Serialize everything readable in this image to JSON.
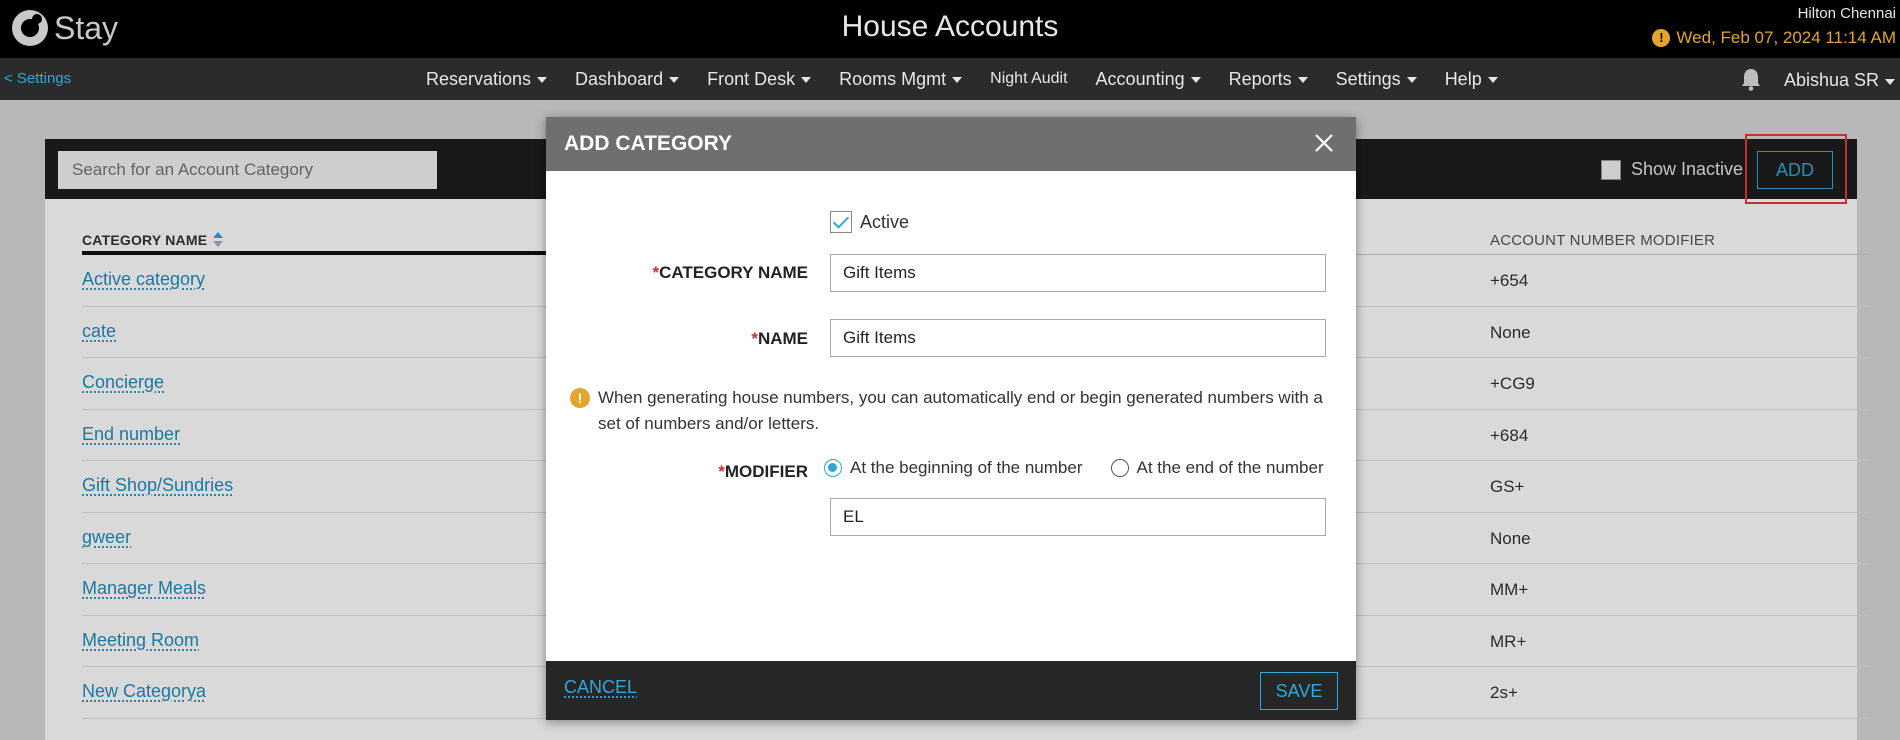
{
  "app": {
    "logo_text": "Stay",
    "page_title": "House Accounts"
  },
  "header": {
    "hotel_name": "Hilton Chennai",
    "datetime": "Wed, Feb 07, 2024 11:14 AM",
    "warning_icon": "!",
    "accent_color": "#e3a52b"
  },
  "nav": {
    "back_label": "<  Settings",
    "items": [
      {
        "label": "Reservations"
      },
      {
        "label": "Dashboard"
      },
      {
        "label": "Front Desk"
      },
      {
        "label": "Rooms Mgmt"
      },
      {
        "label": "Night Audit"
      },
      {
        "label": "Accounting"
      },
      {
        "label": "Reports"
      },
      {
        "label": "Settings"
      },
      {
        "label": "Help"
      }
    ],
    "user_name": "Abishua SR"
  },
  "panel": {
    "search_placeholder": "Search for an Account Category",
    "show_inactive_label": "Show Inactive",
    "add_label": "ADD",
    "col_category": "CATEGORY NAME",
    "col_modifier": "ACCOUNT NUMBER MODIFIER",
    "rows": [
      {
        "name": "Active category",
        "modifier": "+654"
      },
      {
        "name": "cate",
        "modifier": "None"
      },
      {
        "name": "Concierge",
        "modifier": "+CG9"
      },
      {
        "name": "End number",
        "modifier": "+684"
      },
      {
        "name": "Gift Shop/Sundries",
        "modifier": "GS+"
      },
      {
        "name": "gweer",
        "modifier": "None"
      },
      {
        "name": "Manager Meals",
        "modifier": "MM+"
      },
      {
        "name": "Meeting Room",
        "modifier": "MR+"
      },
      {
        "name": "New Categorya",
        "modifier": "2s+"
      }
    ]
  },
  "modal": {
    "title": "ADD CATEGORY",
    "active_label": "Active",
    "required_mark": "*",
    "category_name_label": "CATEGORY NAME",
    "category_name_value": "Gift Items",
    "name_label": "NAME",
    "name_value": "Gift Items",
    "info_icon": "!",
    "info_text": "When generating house numbers, you can automatically end or begin generated numbers with a set of numbers and/or letters.",
    "modifier_label": "MODIFIER",
    "radio_begin": "At the beginning of the number",
    "radio_end": "At the end of the number",
    "modifier_value": "EL",
    "cancel_label": "CANCEL",
    "save_label": "SAVE"
  },
  "colors": {
    "link": "#2da8d8",
    "required": "#d32f2f",
    "highlight": "#e53935"
  }
}
